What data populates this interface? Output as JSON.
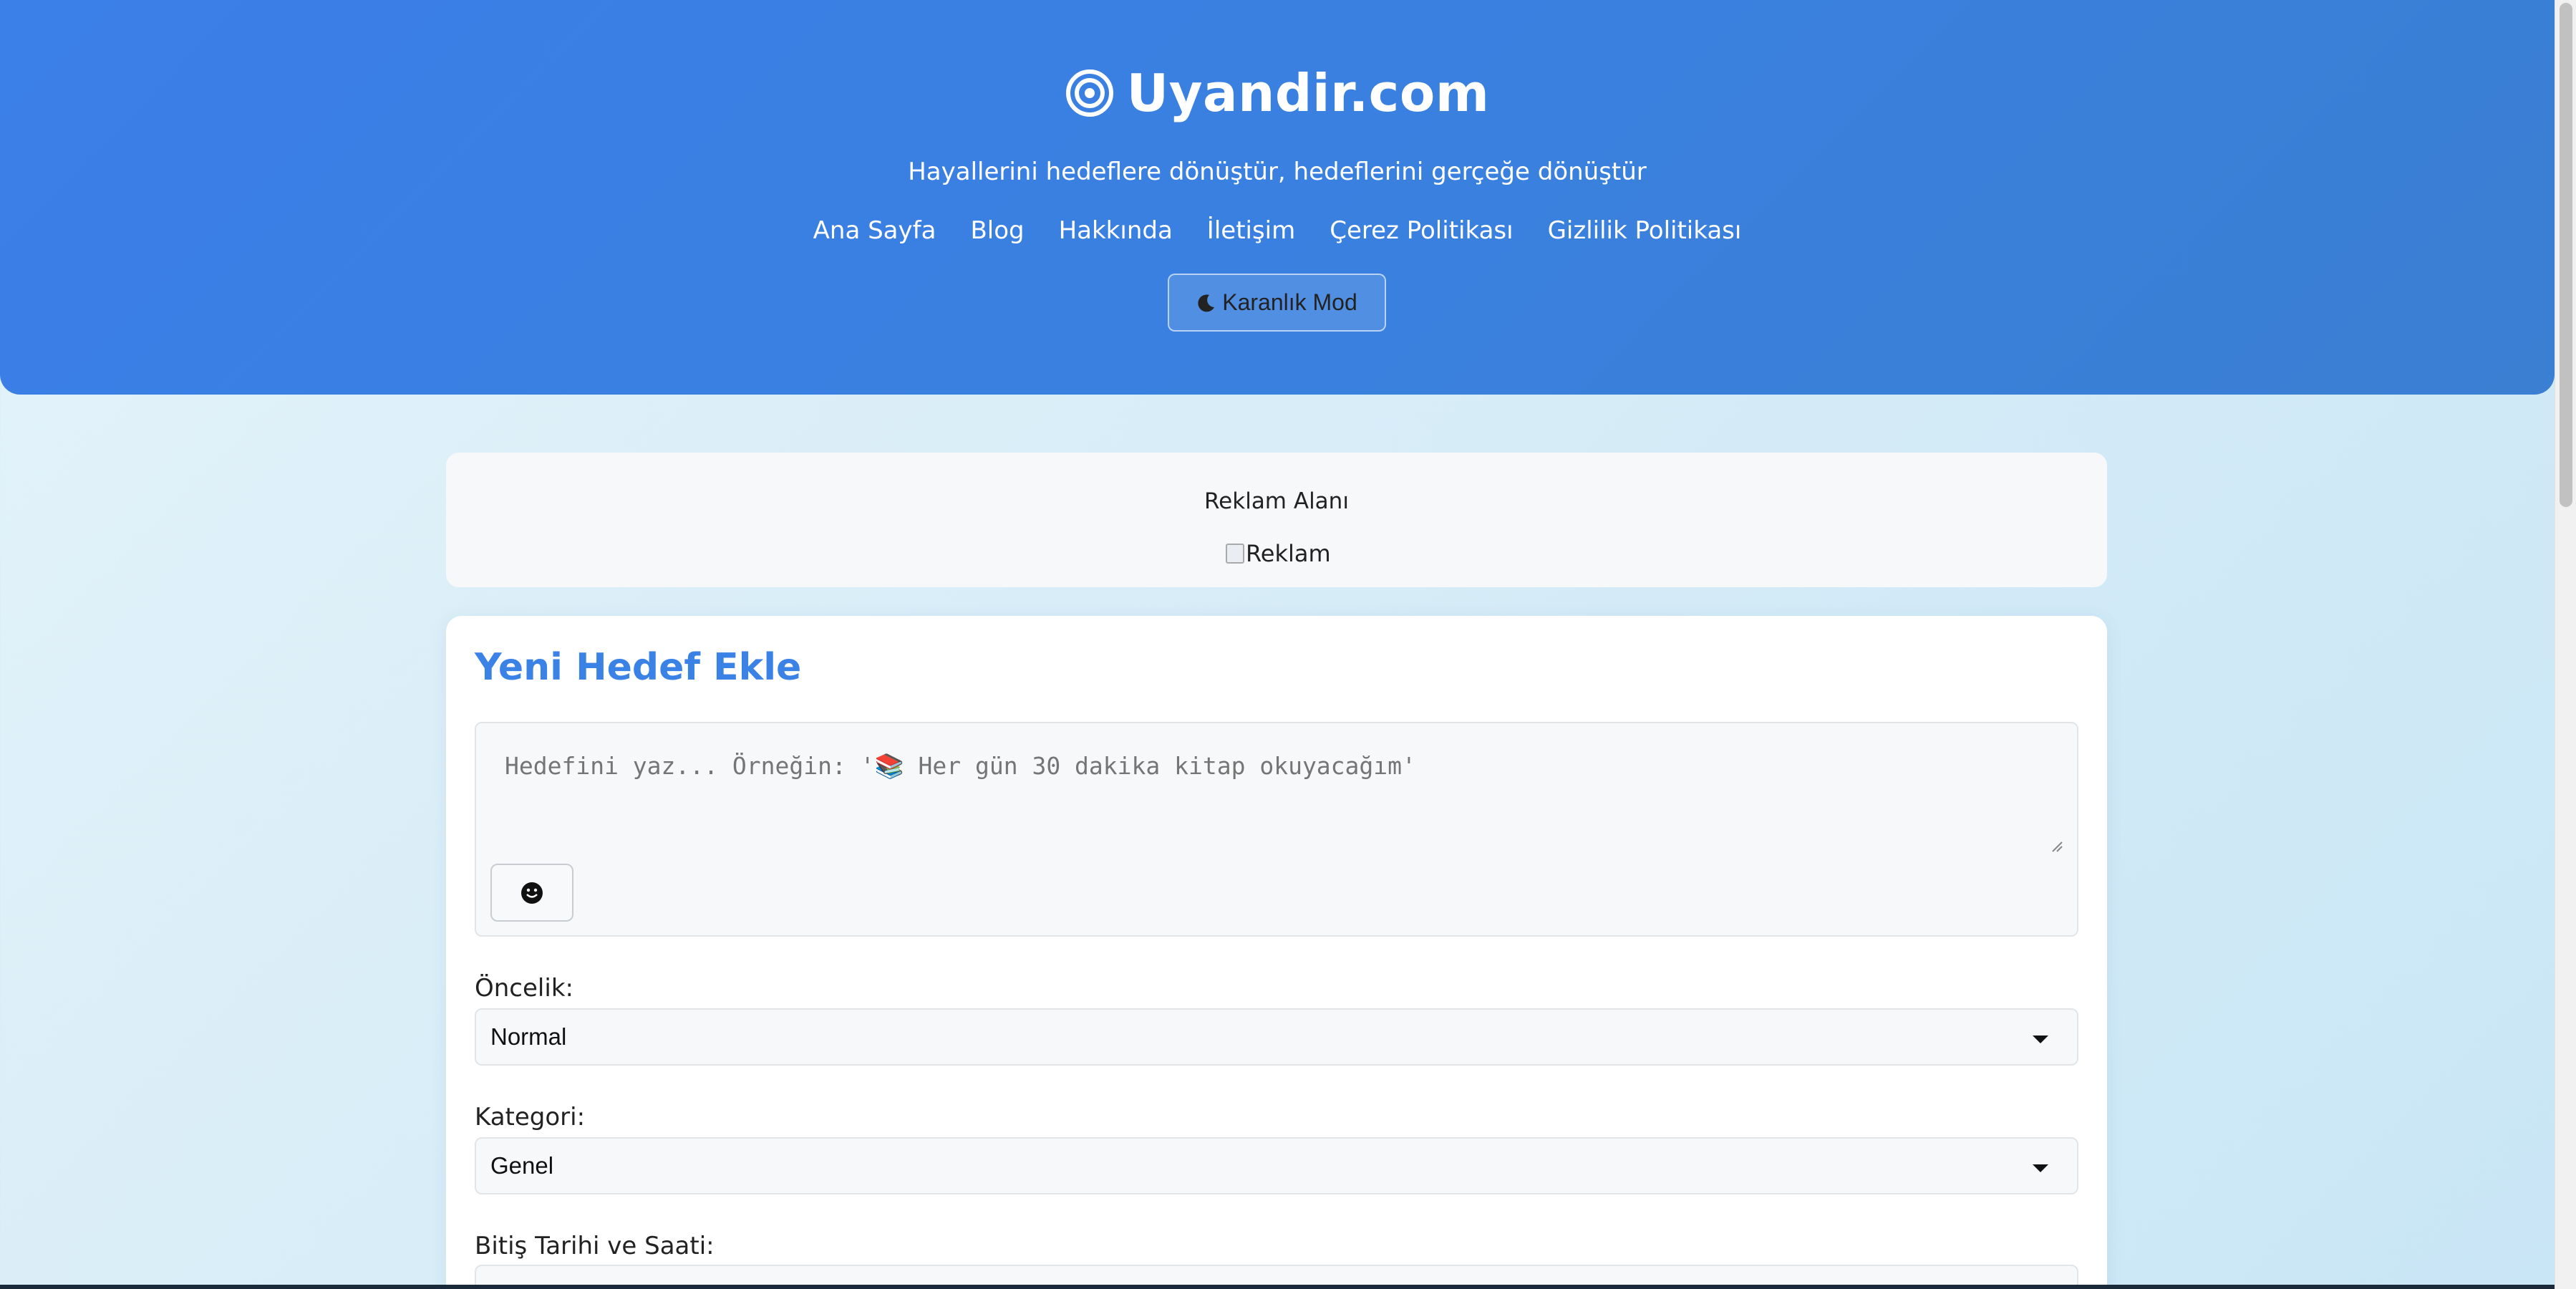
{
  "header": {
    "brand_name": "Uyandir.com",
    "brand_icon": "target-icon",
    "tagline": "Hayallerini hedeflere dönüştür, hedeflerini gerçeğe dönüştür",
    "nav": [
      {
        "label": "Ana Sayfa"
      },
      {
        "label": "Blog"
      },
      {
        "label": "Hakkında"
      },
      {
        "label": "İletişim"
      },
      {
        "label": "Çerez Politikası"
      },
      {
        "label": "Gizlilik Politikası"
      }
    ],
    "dark_mode_label": "Karanlık Mod",
    "dark_mode_icon": "moon-icon"
  },
  "ad": {
    "title": "Reklam Alanı",
    "image_alt": "Reklam"
  },
  "form": {
    "title": "Yeni Hedef Ekle",
    "goal_placeholder": "Hedefini yaz... Örneğin: '📚 Her gün 30 dakika kitap okuyacağım'",
    "emoji_button_icon": "smiley-icon",
    "priority_label": "Öncelik:",
    "priority_value": "Normal",
    "category_label": "Kategori:",
    "category_value": "Genel",
    "deadline_label": "Bitiş Tarihi ve Saati:"
  },
  "colors": {
    "header_gradient_start": "#3b7fe8",
    "header_gradient_end": "#3a7fd2",
    "accent": "#3b82e6",
    "background": "#d6ecf7"
  }
}
